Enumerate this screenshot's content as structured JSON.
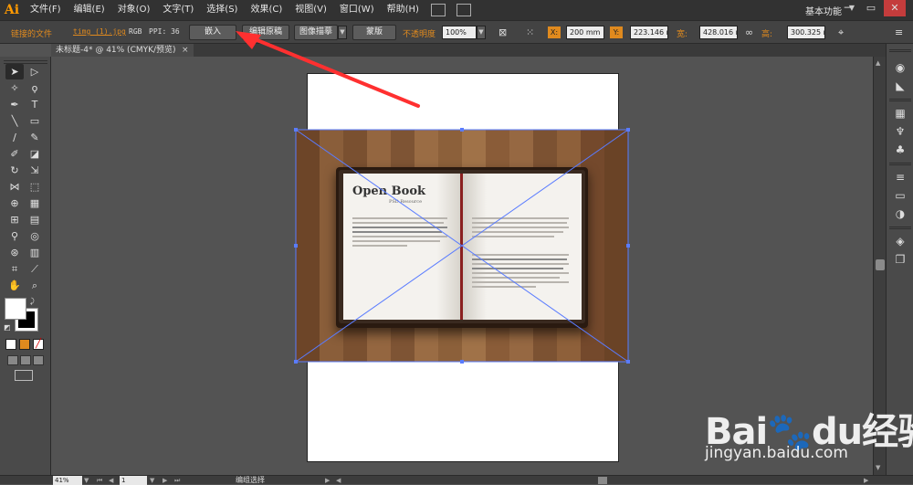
{
  "app": {
    "logo": "Ai"
  },
  "menu": [
    "文件(F)",
    "编辑(E)",
    "对象(O)",
    "文字(T)",
    "选择(S)",
    "效果(C)",
    "视图(V)",
    "窗口(W)",
    "帮助(H)"
  ],
  "workspace": {
    "label": "基本功能",
    "arrow": "▼"
  },
  "window_controls": {
    "minimize": "─",
    "restore": "▭",
    "close": "✕"
  },
  "control_bar": {
    "linked_file_label": "链接的文件",
    "file_name": "timg (1).jpg",
    "color_mode": "RGB",
    "ppi": "PPI: 36",
    "embed_button": "嵌入",
    "edit_original_button": "编辑原稿",
    "image_trace_button": "图像描摹",
    "mask_button": "蒙版",
    "opacity_label": "不透明度",
    "opacity_value": "100%",
    "x_label": "X:",
    "x_value": "200 mm",
    "y_label": "Y:",
    "y_value": "223.146 r",
    "w_label": "宽:",
    "w_value": "428.016 r",
    "h_label": "高:",
    "h_value": "300.325 r"
  },
  "document_tab": {
    "title": "未标题-4* @ 41% (CMYK/预览)",
    "close": "×"
  },
  "book": {
    "title": "Open Book",
    "subtitle": "PSD Resource"
  },
  "status_bar": {
    "zoom": "41%",
    "page": "1",
    "status": "编组选择"
  },
  "watermark": {
    "brand": "Bai🐾du经验",
    "url": "jingyan.baidu.com"
  },
  "colors": {
    "accent": "#e08a1e",
    "bounding_box": "#5a7cff",
    "arrow": "#ff3030"
  }
}
